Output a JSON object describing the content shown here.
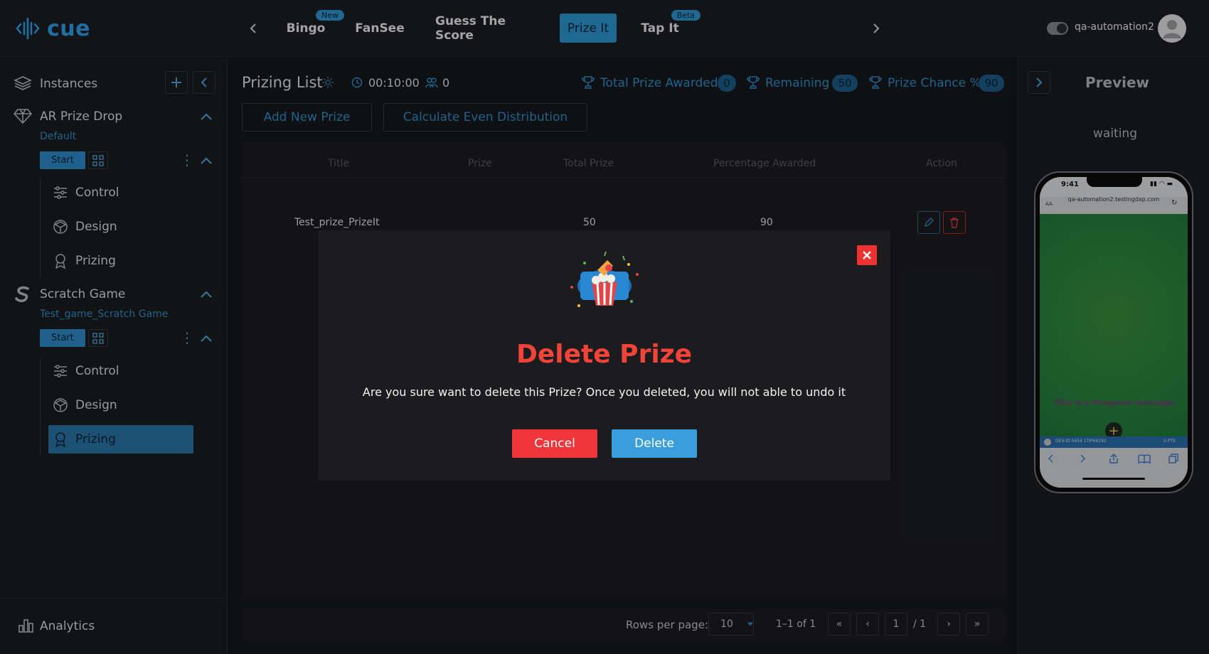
{
  "brand": {
    "name": "cue"
  },
  "nav": {
    "tabs": [
      {
        "label": "Bingo",
        "badge": "New"
      },
      {
        "label": "FanSee"
      },
      {
        "label": "Guess The Score"
      },
      {
        "label": "Prize It",
        "active": true
      },
      {
        "label": "Tap It",
        "badge": "Beta"
      }
    ],
    "user": "qa-automation2"
  },
  "sidebar": {
    "instances_label": "Instances",
    "games": [
      {
        "name": "AR Prize Drop",
        "subtitle": "Default",
        "start_label": "Start",
        "menu": [
          "Control",
          "Design",
          "Prizing"
        ]
      },
      {
        "name": "Scratch Game",
        "subtitle": "Test_game_Scratch Game",
        "start_label": "Start",
        "menu": [
          "Control",
          "Design",
          "Prizing"
        ],
        "active_item": "Prizing"
      }
    ],
    "analytics_label": "Analytics"
  },
  "main": {
    "title": "Prizing List",
    "timer": "00:10:00",
    "participants": "0",
    "stats": {
      "total_awarded_label": "Total Prize Awarded",
      "total_awarded_value": "0",
      "remaining_label": "Remaining",
      "remaining_value": "50",
      "chance_label": "Prize Chance %",
      "chance_value": "90"
    },
    "buttons": {
      "add": "Add New Prize",
      "calc": "Calculate Even Distribution"
    },
    "table": {
      "headers": [
        "Title",
        "Prize",
        "Total Prize",
        "Percentage Awarded",
        "Action"
      ],
      "rows": [
        {
          "title": "Test_prize_PrizeIt",
          "prize": "",
          "total": "50",
          "percent": "90"
        }
      ]
    },
    "pagination": {
      "rows_label": "Rows per page:",
      "rows_value": "10",
      "range": "1–1 of 1",
      "page": "1",
      "of": "/ 1"
    }
  },
  "preview": {
    "title": "Preview",
    "status": "waiting",
    "phone": {
      "time": "9:41",
      "url_prefix": "AA",
      "url": "qa-automation2.testingdxp.com",
      "message": "This is a Pregame message",
      "user_id": "DEV-ID 5654 1TIP66291",
      "points": "0 PTS"
    }
  },
  "modal": {
    "title": "Delete Prize",
    "message": "Are you sure want to delete this Prize? Once you deleted, you will not able to undo it",
    "cancel_label": "Cancel",
    "delete_label": "Delete",
    "title_color": "#f0433a",
    "cancel_color": "#f0363a",
    "delete_color": "#3a9edc"
  },
  "colors": {
    "accent": "#2f9ad8",
    "background": "#17181c"
  }
}
